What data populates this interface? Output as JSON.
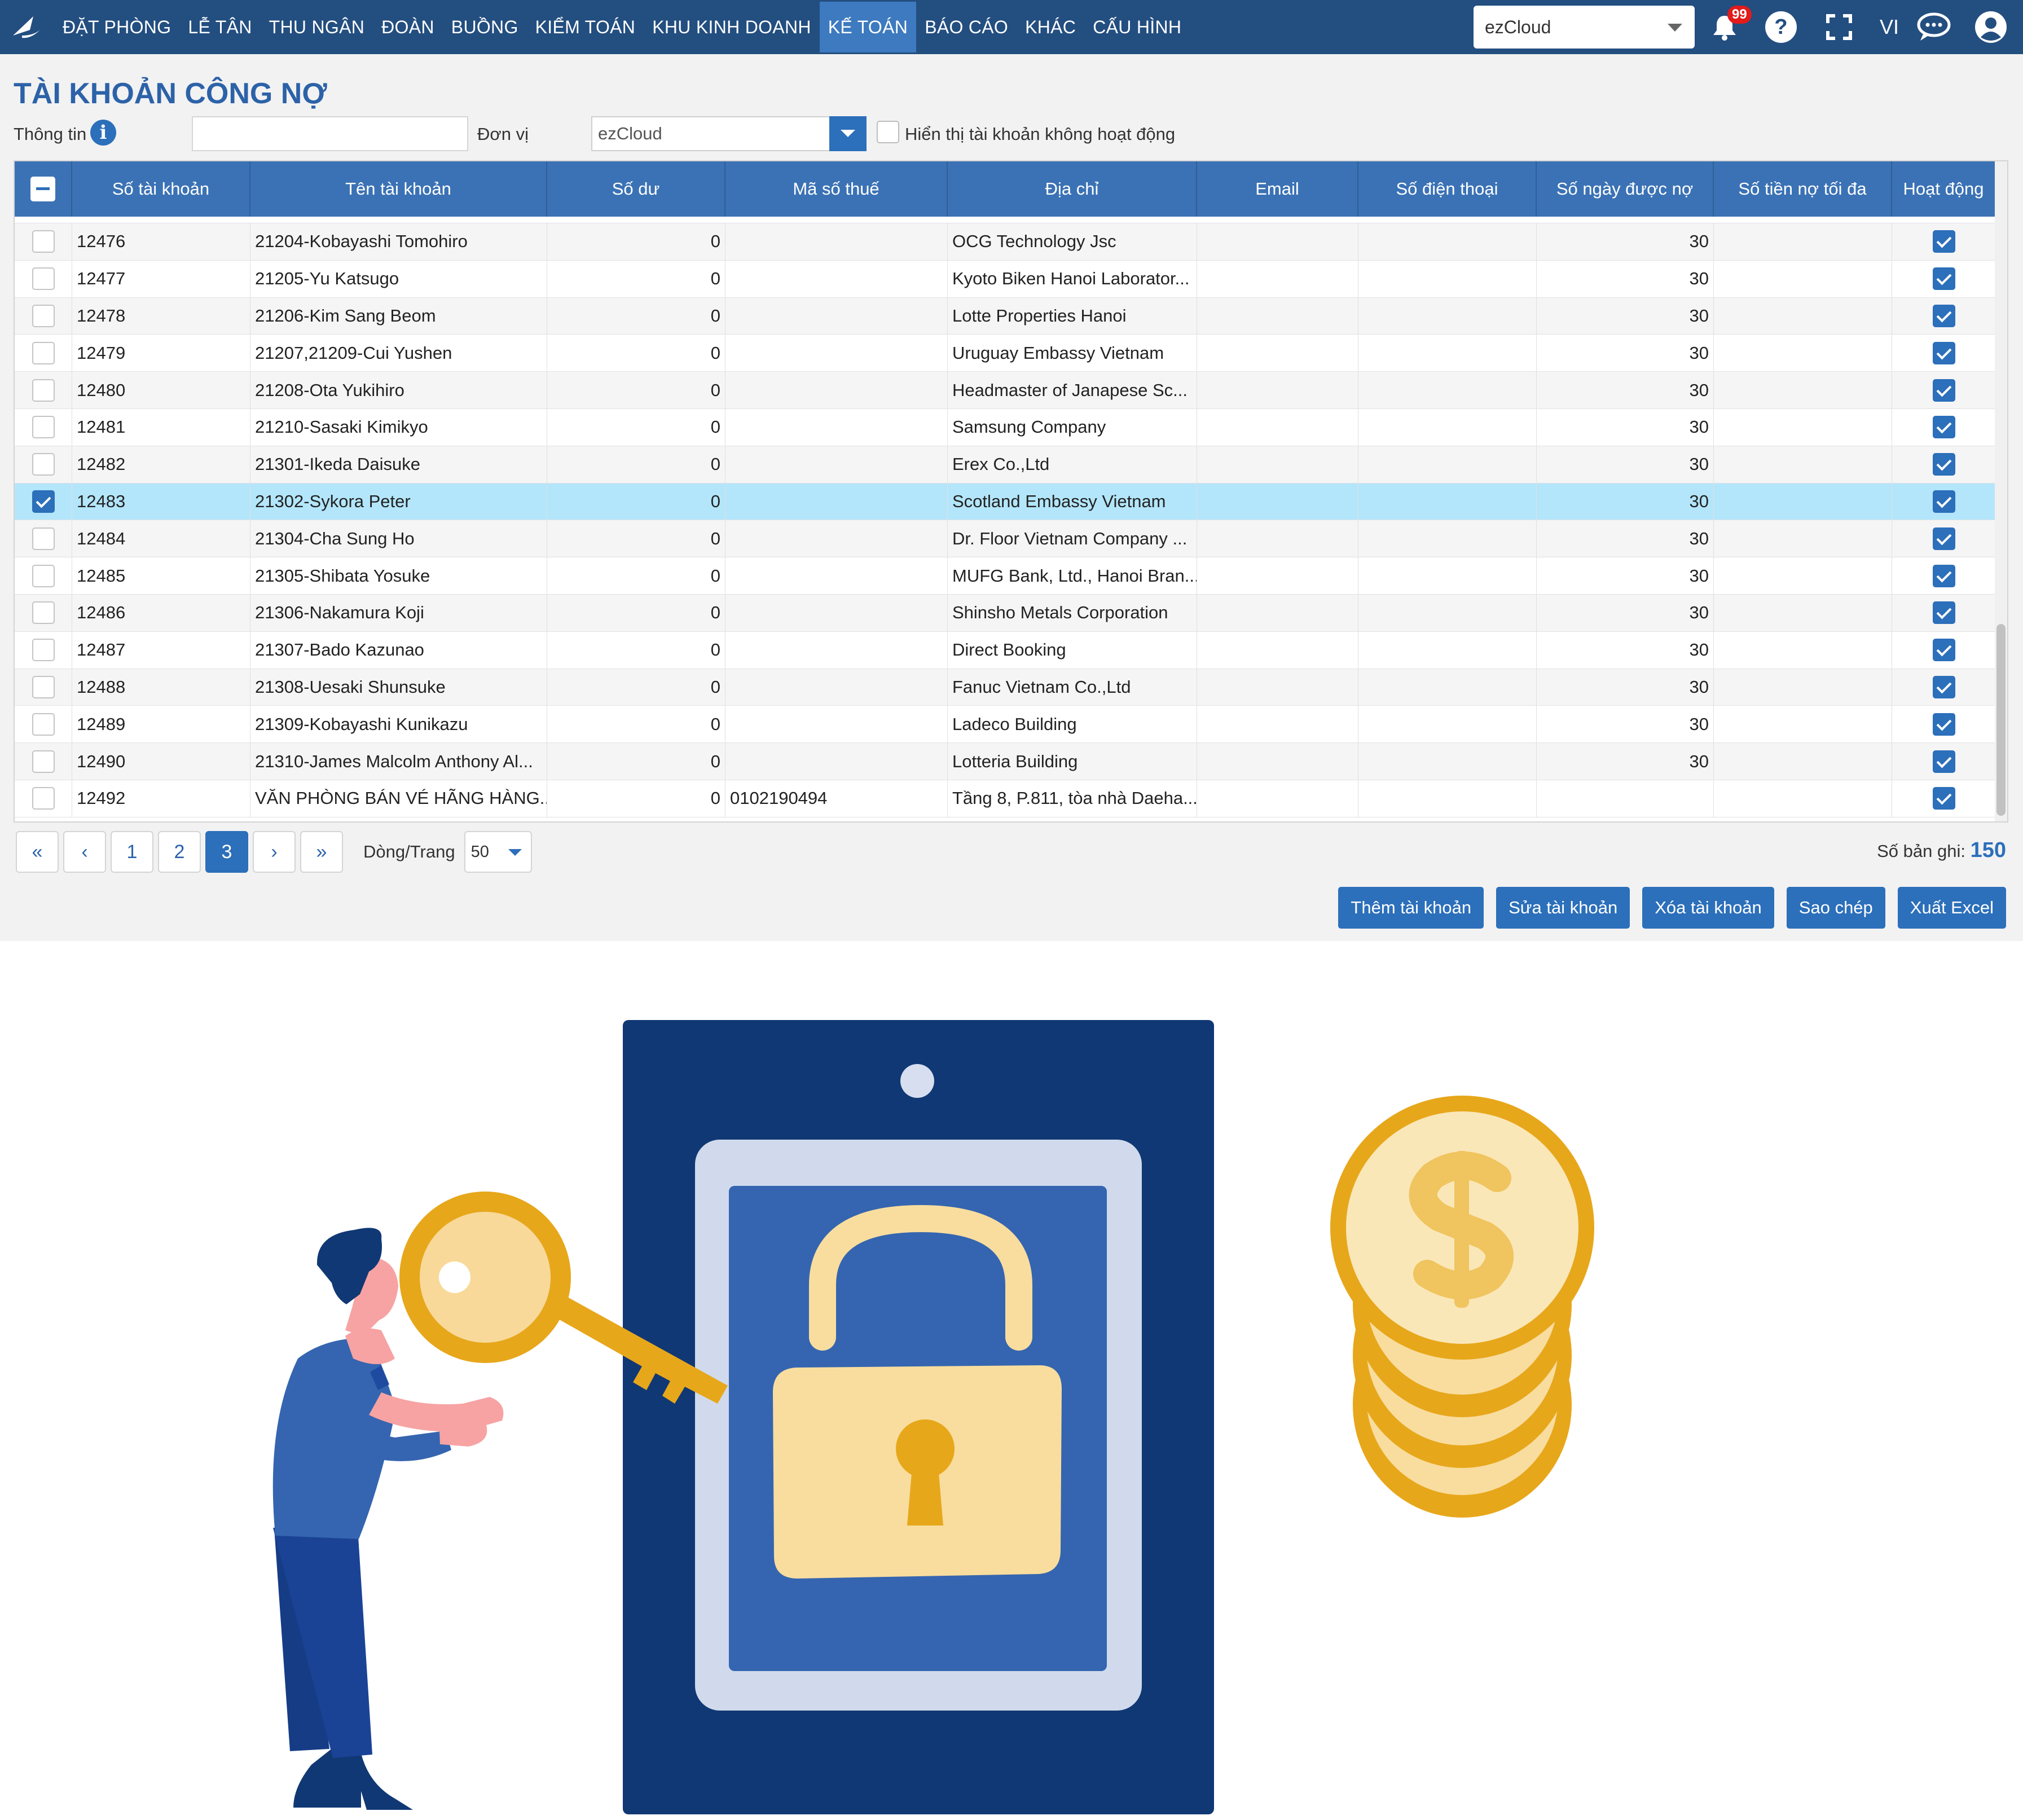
{
  "nav": {
    "menu": [
      "ĐẶT PHÒNG",
      "LỄ TÂN",
      "THU NGÂN",
      "ĐOÀN",
      "BUỒNG",
      "KIỂM TOÁN",
      "KHU KINH DOANH",
      "KẾ TOÁN",
      "BÁO CÁO",
      "KHÁC",
      "CẤU HÌNH"
    ],
    "active": "KẾ TOÁN",
    "unit_selected": "ezCloud",
    "notification_count": "99",
    "language": "VI"
  },
  "page": {
    "title": "TÀI KHOẢN CÔNG NỢ",
    "filter_info_label": "Thông tin",
    "filter_unit_label": "Đơn vị",
    "filter_unit_value": "ezCloud",
    "show_inactive_label": "Hiển thị tài khoản không hoạt động"
  },
  "table": {
    "columns": [
      "Số tài khoản",
      "Tên tài khoản",
      "Số dư",
      "Mã số thuế",
      "Địa chỉ",
      "Email",
      "Số điện thoại",
      "Số ngày được nợ",
      "Số tiền nợ tối đa",
      "Hoạt động"
    ],
    "rows": [
      {
        "account": "12476",
        "name": "21204-Kobayashi Tomohiro",
        "balance": "0",
        "tax": "",
        "address": "OCG Technology Jsc",
        "days": "30",
        "selected": false
      },
      {
        "account": "12477",
        "name": "21205-Yu Katsugo",
        "balance": "0",
        "tax": "",
        "address": "Kyoto Biken Hanoi Laborator...",
        "days": "30",
        "selected": false
      },
      {
        "account": "12478",
        "name": "21206-Kim Sang Beom",
        "balance": "0",
        "tax": "",
        "address": "Lotte Properties Hanoi",
        "days": "30",
        "selected": false
      },
      {
        "account": "12479",
        "name": "21207,21209-Cui Yushen",
        "balance": "0",
        "tax": "",
        "address": "Uruguay Embassy Vietnam",
        "days": "30",
        "selected": false
      },
      {
        "account": "12480",
        "name": "21208-Ota Yukihiro",
        "balance": "0",
        "tax": "",
        "address": "Headmaster of Janapese Sc...",
        "days": "30",
        "selected": false
      },
      {
        "account": "12481",
        "name": "21210-Sasaki Kimikyo",
        "balance": "0",
        "tax": "",
        "address": "Samsung Company",
        "days": "30",
        "selected": false
      },
      {
        "account": "12482",
        "name": "21301-Ikeda Daisuke",
        "balance": "0",
        "tax": "",
        "address": "Erex Co.,Ltd",
        "days": "30",
        "selected": false
      },
      {
        "account": "12483",
        "name": "21302-Sykora Peter",
        "balance": "0",
        "tax": "",
        "address": "Scotland Embassy Vietnam",
        "days": "30",
        "selected": true
      },
      {
        "account": "12484",
        "name": "21304-Cha Sung Ho",
        "balance": "0",
        "tax": "",
        "address": "Dr. Floor Vietnam Company ...",
        "days": "30",
        "selected": false
      },
      {
        "account": "12485",
        "name": "21305-Shibata Yosuke",
        "balance": "0",
        "tax": "",
        "address": "MUFG Bank, Ltd., Hanoi Bran...",
        "days": "30",
        "selected": false
      },
      {
        "account": "12486",
        "name": "21306-Nakamura Koji",
        "balance": "0",
        "tax": "",
        "address": "Shinsho Metals Corporation",
        "days": "30",
        "selected": false
      },
      {
        "account": "12487",
        "name": "21307-Bado Kazunao",
        "balance": "0",
        "tax": "",
        "address": "Direct Booking",
        "days": "30",
        "selected": false
      },
      {
        "account": "12488",
        "name": "21308-Uesaki Shunsuke",
        "balance": "0",
        "tax": "",
        "address": "Fanuc Vietnam Co.,Ltd",
        "days": "30",
        "selected": false
      },
      {
        "account": "12489",
        "name": "21309-Kobayashi Kunikazu",
        "balance": "0",
        "tax": "",
        "address": "Ladeco Building",
        "days": "30",
        "selected": false
      },
      {
        "account": "12490",
        "name": "21310-James Malcolm Anthony Al...",
        "balance": "0",
        "tax": "",
        "address": "Lotteria Building",
        "days": "30",
        "selected": false
      },
      {
        "account": "12492",
        "name": "VĂN PHÒNG BÁN VÉ HÃNG HÀNG...",
        "balance": "0",
        "tax": "0102190494",
        "address": "Tầng 8, P.811, tòa nhà Daeha...",
        "days": "",
        "selected": false
      }
    ]
  },
  "pager": {
    "first": "«",
    "prev": "‹",
    "pages": [
      "1",
      "2",
      "3"
    ],
    "current": "3",
    "next": "›",
    "last": "»",
    "rows_label": "Dòng/Trang",
    "rows_value": "50",
    "total_label": "Số bản ghi:",
    "total_value": "150"
  },
  "actions": [
    "Thêm tài khoản",
    "Sửa tài khoản",
    "Xóa tài khoản",
    "Sao chép",
    "Xuất Excel"
  ],
  "colors": {
    "nav_bg": "#234e80",
    "nav_active": "#3d7abf",
    "header_bg": "#3b72b5",
    "accent": "#2c6fba",
    "selected_row": "#b3e6fb",
    "panel_bg": "#f2f2f2",
    "safe_dark": "#103874",
    "safe_inner": "#3565b0",
    "gold": "#ecb22e",
    "gold_light": "#f8dd9e"
  }
}
